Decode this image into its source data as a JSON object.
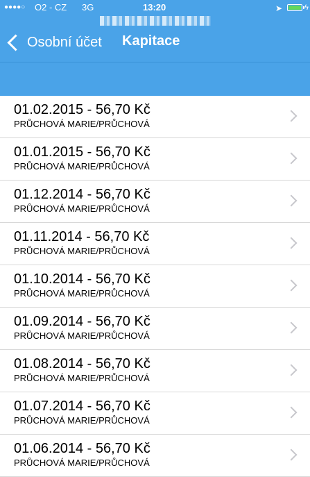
{
  "status_bar": {
    "signal": "●●●●○",
    "carrier": "O2 - CZ",
    "network": "3G",
    "time": "13:20",
    "location_icon": "location-arrow-icon",
    "battery_icon": "battery-charging-icon",
    "bolt": "ϟ"
  },
  "nav": {
    "back_label": "Osobní účet",
    "title": "Kapitace"
  },
  "rows": [
    {
      "title": "01.02.2015 - 56,70 Kč",
      "subtitle": "PRŮCHOVÁ MARIE/PRŮCHOVÁ"
    },
    {
      "title": "01.01.2015 - 56,70 Kč",
      "subtitle": "PRŮCHOVÁ MARIE/PRŮCHOVÁ"
    },
    {
      "title": "01.12.2014 - 56,70 Kč",
      "subtitle": "PRŮCHOVÁ MARIE/PRŮCHOVÁ"
    },
    {
      "title": "01.11.2014 - 56,70 Kč",
      "subtitle": "PRŮCHOVÁ MARIE/PRŮCHOVÁ"
    },
    {
      "title": "01.10.2014 - 56,70 Kč",
      "subtitle": "PRŮCHOVÁ MARIE/PRŮCHOVÁ"
    },
    {
      "title": "01.09.2014 - 56,70 Kč",
      "subtitle": "PRŮCHOVÁ MARIE/PRŮCHOVÁ"
    },
    {
      "title": "01.08.2014 - 56,70 Kč",
      "subtitle": "PRŮCHOVÁ MARIE/PRŮCHOVÁ"
    },
    {
      "title": "01.07.2014 - 56,70 Kč",
      "subtitle": "PRŮCHOVÁ MARIE/PRŮCHOVÁ"
    },
    {
      "title": "01.06.2014 - 56,70 Kč",
      "subtitle": "PRŮCHOVÁ MARIE/PRŮCHOVÁ"
    }
  ],
  "colors": {
    "header_blue": "#4aa3e8",
    "separator": "#d8d8d8",
    "chevron": "#c7c7cc"
  }
}
